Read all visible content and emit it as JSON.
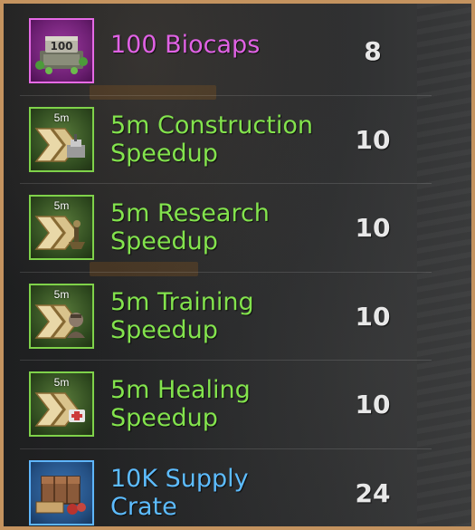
{
  "rewards": [
    {
      "name": "100 Biocaps",
      "quantity": "8",
      "rarity_color": "#e062e4",
      "icon": "biocaps-crate-icon",
      "icon_label": "100"
    },
    {
      "name_line1": "5m Construction",
      "name_line2": "Speedup",
      "quantity": "10",
      "rarity_color": "#83e34d",
      "icon": "construction-speedup-icon",
      "icon_label": "5m"
    },
    {
      "name_line1": "5m Research",
      "name_line2": "Speedup",
      "quantity": "10",
      "rarity_color": "#83e34d",
      "icon": "research-speedup-icon",
      "icon_label": "5m"
    },
    {
      "name_line1": "5m Training",
      "name_line2": "Speedup",
      "quantity": "10",
      "rarity_color": "#83e34d",
      "icon": "training-speedup-icon",
      "icon_label": "5m"
    },
    {
      "name_line1": "5m Healing",
      "name_line2": "Speedup",
      "quantity": "10",
      "rarity_color": "#83e34d",
      "icon": "healing-speedup-icon",
      "icon_label": "5m"
    },
    {
      "name_line1": "10K Supply",
      "name_line2": "Crate",
      "quantity": "24",
      "rarity_color": "#5dbcff",
      "icon": "supply-crate-icon"
    }
  ]
}
